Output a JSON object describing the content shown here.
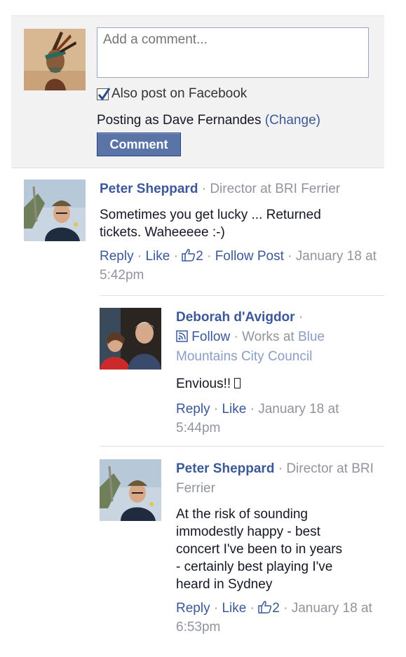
{
  "composer": {
    "placeholder": "Add a comment...",
    "also_post_label": "Also post on Facebook",
    "also_post_checked": true,
    "posting_as_prefix": "Posting as Dave Fernandes",
    "change_link": "(Change)",
    "comment_button": "Comment"
  },
  "comments": [
    {
      "author": "Peter Sheppard",
      "sep": " · ",
      "headline": "Director at BRI Ferrier",
      "text": "Sometimes you get lucky ... Returned tickets. Waheeeee :-)",
      "reply": "Reply",
      "like": "Like",
      "like_count": "2",
      "follow_post": "Follow Post",
      "timestamp": "January 18 at 5:42pm"
    },
    {
      "author": "Deborah d'Avigdor",
      "follow_label": "Follow",
      "works_prefix": "Works at ",
      "works_org": "Blue Mountains City Council",
      "text": "Envious!! ",
      "reply": "Reply",
      "like": "Like",
      "timestamp": "January 18 at 5:44pm"
    },
    {
      "author": "Peter Sheppard",
      "headline": "Director at BRI Ferrier",
      "text": "At the risk of sounding immodestly happy - best concert I've been to in years - certainly best playing I've heard in Sydney",
      "reply": "Reply",
      "like": "Like",
      "like_count": "2",
      "timestamp": "January 18 at 6:53pm"
    }
  ],
  "colors": {
    "link": "#3b5998",
    "meta_grey": "#90949c",
    "button_bg": "#5b74a8"
  },
  "icons": [
    "checkmark-icon",
    "thumbs-up-icon",
    "rss-follow-icon"
  ]
}
